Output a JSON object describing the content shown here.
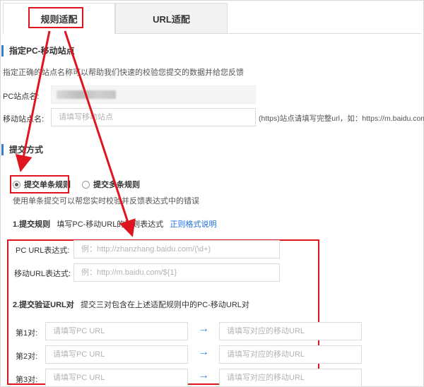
{
  "tabs": [
    {
      "label": "规则适配",
      "active": true
    },
    {
      "label": "URL适配",
      "active": false
    }
  ],
  "section1": {
    "title": "指定PC-移动站点",
    "desc": "指定正确的站点名称可以帮助我们快速的校验您提交的数据并给您反馈",
    "pc_site_label": "PC站点名:",
    "mobile_site_label": "移动站点名:",
    "mobile_site_placeholder": "请填写移动站点",
    "mobile_site_hint": "(https)站点请填写完整url，如：https://m.baidu.com)"
  },
  "section2": {
    "title": "提交方式",
    "radio_single": "提交单条规则",
    "radio_multi": "提交多条规则",
    "radio_single_selected": true,
    "hint": "使用单条提交可以帮您实时校验并反馈表达式中的错误"
  },
  "step1": {
    "title": "1.提交规则",
    "desc": "填写PC-移动URL的正则表达式",
    "link": "正则格式说明",
    "pc_url_label": "PC  URL表达式:",
    "pc_url_placeholder": "例：http://zhanzhang.baidu.com/(\\d+)",
    "mobile_url_label": "移动URL表达式:",
    "mobile_url_placeholder": "例：http://m.baidu.com/${1}"
  },
  "step2": {
    "title": "2.提交验证URL对",
    "desc": "提交三对包含在上述适配规则中的PC-移动URL对",
    "pairs": [
      {
        "label": "第1对:",
        "pc_placeholder": "请填写PC URL",
        "mobile_placeholder": "请填写对应的移动URL"
      },
      {
        "label": "第2对:",
        "pc_placeholder": "请填写PC URL",
        "mobile_placeholder": "请填写对应的移动URL"
      },
      {
        "label": "第3对:",
        "pc_placeholder": "请填写PC URL",
        "mobile_placeholder": "请填写对应的移动URL"
      }
    ],
    "arrow": "→"
  },
  "colors": {
    "annotation_red": "#e0141e",
    "accent_blue": "#3a7bd5",
    "link_blue": "#1e6fd9"
  }
}
